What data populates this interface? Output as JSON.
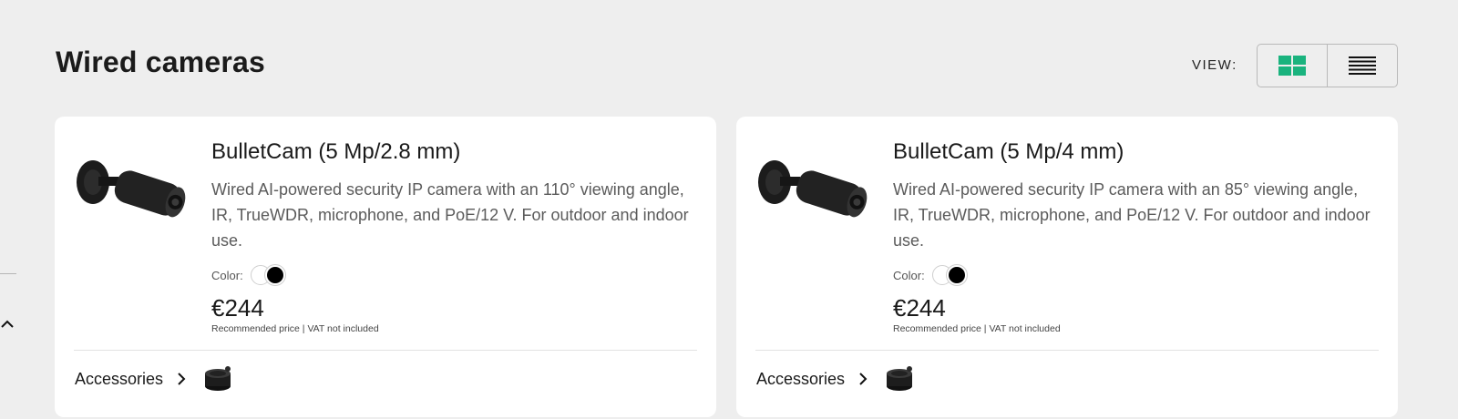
{
  "page": {
    "title": "Wired cameras",
    "view_label": "VIEW:",
    "view_modes": [
      "grid-icon",
      "list-icon"
    ],
    "active_view": "grid"
  },
  "colors": {
    "accent": "#1ab37e",
    "background": "#eeeeee",
    "card": "#ffffff"
  },
  "products": [
    {
      "title": "BulletCam (5 Mp/2.8 mm)",
      "description": "Wired AI-powered security IP camera with an 110° viewing angle, IR, TrueWDR, microphone, and PoE/12 V. For outdoor and indoor use.",
      "color_label": "Color:",
      "colors": [
        "white",
        "black"
      ],
      "selected_color": "black",
      "price": "€244",
      "price_note": "Recommended price | VAT not included",
      "accessories_label": "Accessories"
    },
    {
      "title": "BulletCam (5 Mp/4 mm)",
      "description": "Wired AI-powered security IP camera with an 85° viewing angle, IR, TrueWDR, microphone, and PoE/12 V. For outdoor and indoor use.",
      "color_label": "Color:",
      "colors": [
        "white",
        "black"
      ],
      "selected_color": "black",
      "price": "€244",
      "price_note": "Recommended price | VAT not included",
      "accessories_label": "Accessories"
    }
  ]
}
